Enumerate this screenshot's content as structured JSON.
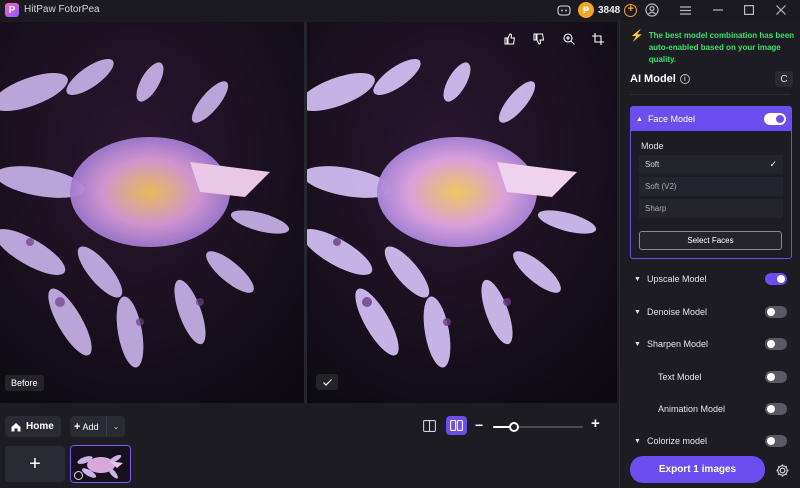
{
  "titlebar": {
    "app_name": "HitPaw FotorPea",
    "logo_letter": "P",
    "credits": "3848",
    "icons": [
      "discord-icon",
      "coin-icon",
      "add-credit-icon",
      "account-icon",
      "menu-icon",
      "minimize-icon",
      "maximize-icon",
      "close-icon"
    ]
  },
  "preview": {
    "before_label": "Before",
    "after_badge_icon": "check-icon",
    "tools": [
      "thumbs-up-icon",
      "thumbs-down-icon",
      "zoom-in-icon",
      "crop-icon"
    ]
  },
  "bottom": {
    "home_label": "Home",
    "add_label": "Add",
    "add_tile_symbol": "+",
    "zoom_level": 0.2
  },
  "sidebar": {
    "tip": "The best model combination has been auto-enabled based on your image quality.",
    "section_title": "AI Model",
    "refresh_symbol": "C",
    "face_model": {
      "label": "Face Model",
      "enabled": true,
      "mode_label": "Mode",
      "options": [
        "Soft",
        "Soft (V2)",
        "Sharp"
      ],
      "selected": "Soft",
      "select_faces_label": "Select Faces"
    },
    "models": [
      {
        "label": "Upscale Model",
        "enabled": true,
        "has_caret": true
      },
      {
        "label": "Denoise Model",
        "enabled": false,
        "has_caret": true
      },
      {
        "label": "Sharpen Model",
        "enabled": false,
        "has_caret": true
      },
      {
        "label": "Text Model",
        "enabled": false,
        "has_caret": false
      },
      {
        "label": "Animation Model",
        "enabled": false,
        "has_caret": false
      },
      {
        "label": "Colorize model",
        "enabled": false,
        "has_caret": true
      }
    ],
    "export_label": "Export 1 images"
  },
  "colors": {
    "accent": "#6c4ef0",
    "tip_green": "#39e36f",
    "coin": "#f5a623"
  }
}
